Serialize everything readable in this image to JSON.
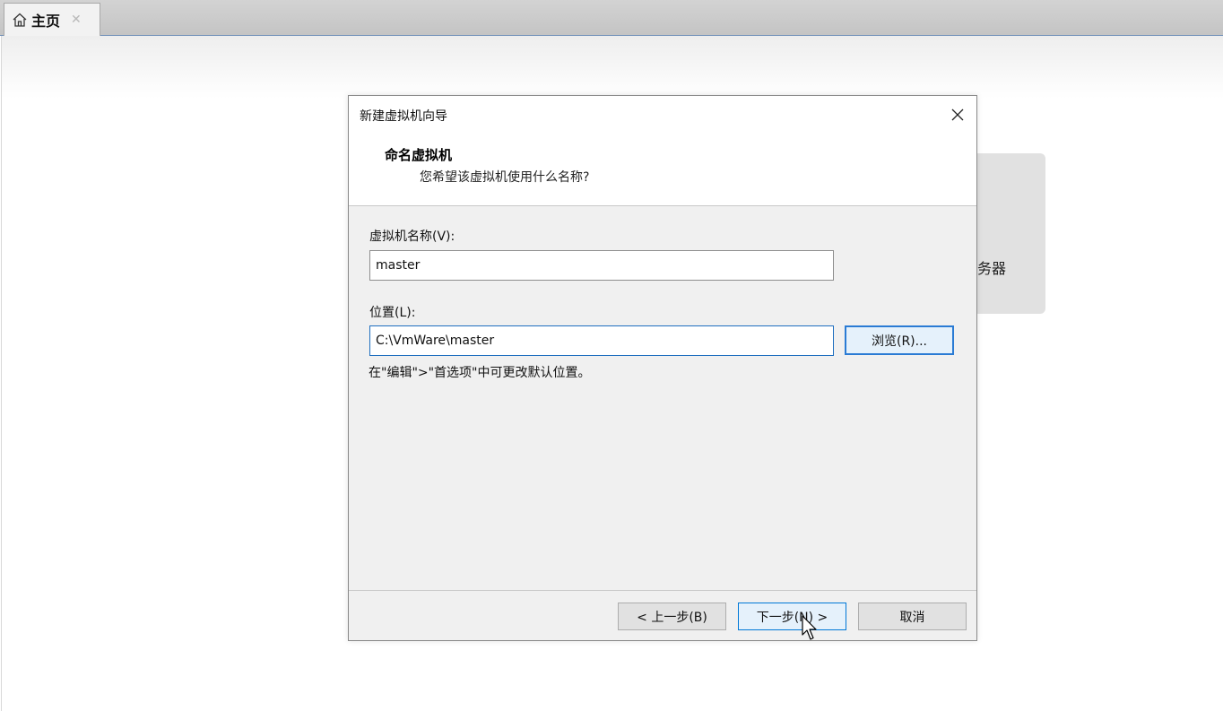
{
  "tabs": [
    {
      "label": "主页",
      "icon": "home-icon",
      "closable": true
    }
  ],
  "background": {
    "tile_text": "务器"
  },
  "dialog": {
    "title": "新建虚拟机向导",
    "heading": "命名虚拟机",
    "subheading": "您希望该虚拟机使用什么名称?",
    "name_label": "虚拟机名称(V):",
    "name_value": "master",
    "location_label": "位置(L):",
    "location_value": "C:\\VmWare\\master",
    "browse_label": "浏览(R)...",
    "hint": "在\"编辑\">\"首选项\"中可更改默认位置。",
    "back_label": "< 上一步(B)",
    "next_label": "下一步(N) >",
    "cancel_label": "取消"
  },
  "colors": {
    "accent": "#2a7bd4",
    "dialog_bg": "#f0f0f0",
    "tabbar_bg": "#c8c8c8"
  }
}
